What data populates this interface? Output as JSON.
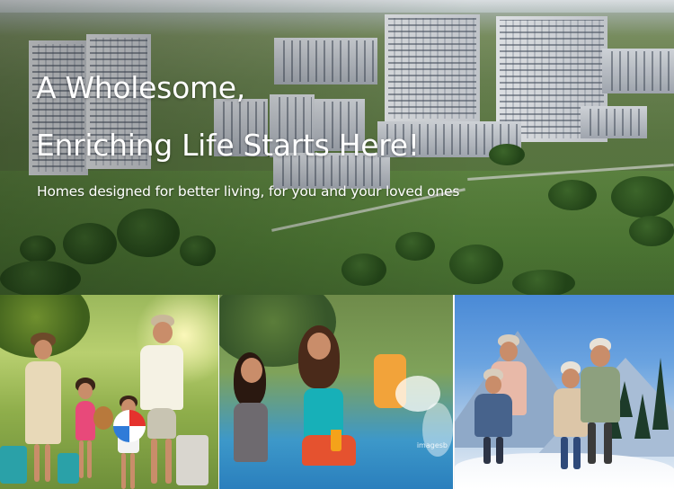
{
  "hero": {
    "title_line1": "A Wholesome,",
    "title_line2": "Enriching Life Starts Here!",
    "subtitle": "Homes designed for better living, for you and your loved ones"
  },
  "gallery": {
    "panels": [
      {
        "scene": "family-travel-photo"
      },
      {
        "scene": "pool-photo",
        "watermark": "imagesb"
      },
      {
        "scene": "snow-photo"
      }
    ]
  },
  "colors": {
    "hero_text": "#ffffff",
    "lawn_green": "#5f8742",
    "sky_blue": "#4a8ad6",
    "pool_blue": "#2a7fbd"
  }
}
